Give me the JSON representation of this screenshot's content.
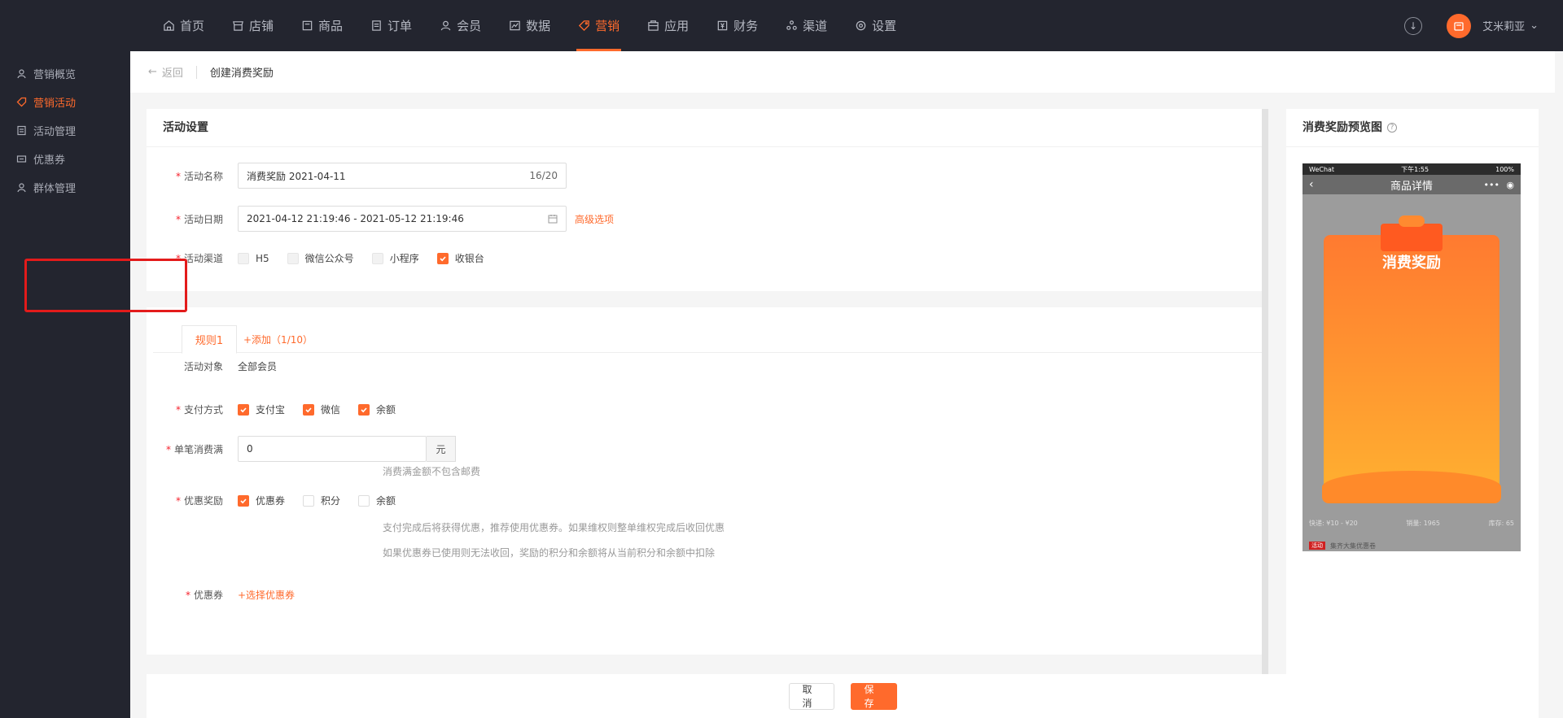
{
  "topnav": {
    "items": [
      {
        "label": "首页",
        "icon": "home-icon"
      },
      {
        "label": "店铺",
        "icon": "store-icon"
      },
      {
        "label": "商品",
        "icon": "product-icon"
      },
      {
        "label": "订单",
        "icon": "order-icon"
      },
      {
        "label": "会员",
        "icon": "member-icon"
      },
      {
        "label": "数据",
        "icon": "chart-icon"
      },
      {
        "label": "营销",
        "icon": "tag-icon",
        "active": true
      },
      {
        "label": "应用",
        "icon": "app-icon"
      },
      {
        "label": "财务",
        "icon": "finance-icon"
      },
      {
        "label": "渠道",
        "icon": "channel-icon"
      },
      {
        "label": "设置",
        "icon": "settings-icon"
      }
    ],
    "user_name": "艾米莉亚",
    "accent": "#ff6a2c"
  },
  "sidebar": {
    "items": [
      {
        "label": "营销概览"
      },
      {
        "label": "营销活动",
        "active": true
      },
      {
        "label": "活动管理"
      },
      {
        "label": "优惠券"
      },
      {
        "label": "群体管理"
      }
    ]
  },
  "header": {
    "back_label": "返回",
    "title": "创建消费奖励"
  },
  "settings": {
    "title": "活动设置",
    "name_label": "活动名称",
    "name_value": "消费奖励  2021-04-11",
    "name_count": "16/20",
    "date_label": "活动日期",
    "date_value": "2021-04-12 21:19:46 - 2021-05-12 21:19:46",
    "advanced_label": "高级选项",
    "channel_label": "活动渠道",
    "channels": [
      {
        "label": "H5",
        "checked": false
      },
      {
        "label": "微信公众号",
        "checked": false
      },
      {
        "label": "小程序",
        "checked": false
      },
      {
        "label": "收银台",
        "checked": true
      }
    ]
  },
  "rules": {
    "tab_label": "规则1",
    "add_label": "+添加（1/10）",
    "target_label": "活动对象",
    "target_value": "全部会员",
    "pay_label": "支付方式",
    "pay_methods": [
      {
        "label": "支付宝",
        "checked": true
      },
      {
        "label": "微信",
        "checked": true
      },
      {
        "label": "余额",
        "checked": true
      }
    ],
    "min_label": "单笔消费满",
    "min_value": "0",
    "min_unit": "元",
    "min_hint": "消费满金额不包含邮费",
    "reward_label": "优惠奖励",
    "rewards": [
      {
        "label": "优惠券",
        "checked": true
      },
      {
        "label": "积分",
        "checked": false
      },
      {
        "label": "余额",
        "checked": false
      }
    ],
    "reward_hint1": "支付完成后将获得优惠，推荐使用优惠券。如果维权则整单维权完成后收回优惠",
    "reward_hint2": "如果优惠券已使用则无法收回，奖励的积分和余额将从当前积分和余额中扣除",
    "coupon_label": "优惠券",
    "coupon_action": "+选择优惠券"
  },
  "preview": {
    "title": "消费奖励预览图",
    "status_left": "WeChat",
    "status_time": "下午1:55",
    "status_right": "100%",
    "nav_title": "商品详情",
    "reward_title": "消费奖励",
    "footer_left": "快递: ¥10 - ¥20",
    "footer_mid": "销量: 1965",
    "footer_right": "库存: 65",
    "footer2_tag": "活动",
    "footer2_text": "集齐大集优惠卷"
  },
  "actions": {
    "cancel_label": "取消",
    "save_label": "保存"
  }
}
